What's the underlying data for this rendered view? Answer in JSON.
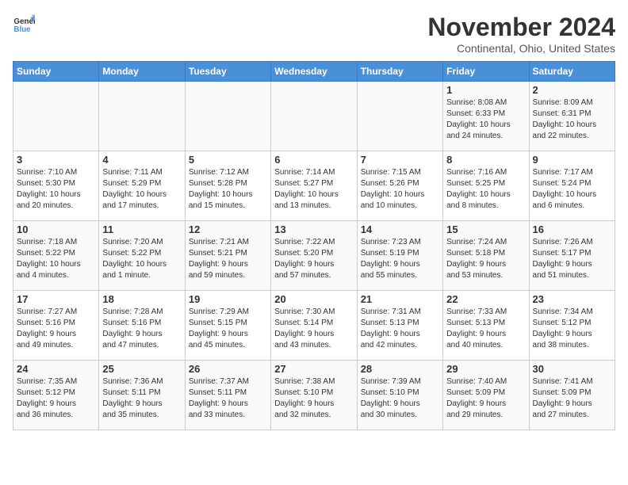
{
  "logo": {
    "line1": "General",
    "line2": "Blue"
  },
  "title": "November 2024",
  "subtitle": "Continental, Ohio, United States",
  "header": {
    "accent_color": "#4a90d9"
  },
  "weekdays": [
    "Sunday",
    "Monday",
    "Tuesday",
    "Wednesday",
    "Thursday",
    "Friday",
    "Saturday"
  ],
  "weeks": [
    [
      {
        "day": "",
        "info": ""
      },
      {
        "day": "",
        "info": ""
      },
      {
        "day": "",
        "info": ""
      },
      {
        "day": "",
        "info": ""
      },
      {
        "day": "",
        "info": ""
      },
      {
        "day": "1",
        "info": "Sunrise: 8:08 AM\nSunset: 6:33 PM\nDaylight: 10 hours\nand 24 minutes."
      },
      {
        "day": "2",
        "info": "Sunrise: 8:09 AM\nSunset: 6:31 PM\nDaylight: 10 hours\nand 22 minutes."
      }
    ],
    [
      {
        "day": "3",
        "info": "Sunrise: 7:10 AM\nSunset: 5:30 PM\nDaylight: 10 hours\nand 20 minutes."
      },
      {
        "day": "4",
        "info": "Sunrise: 7:11 AM\nSunset: 5:29 PM\nDaylight: 10 hours\nand 17 minutes."
      },
      {
        "day": "5",
        "info": "Sunrise: 7:12 AM\nSunset: 5:28 PM\nDaylight: 10 hours\nand 15 minutes."
      },
      {
        "day": "6",
        "info": "Sunrise: 7:14 AM\nSunset: 5:27 PM\nDaylight: 10 hours\nand 13 minutes."
      },
      {
        "day": "7",
        "info": "Sunrise: 7:15 AM\nSunset: 5:26 PM\nDaylight: 10 hours\nand 10 minutes."
      },
      {
        "day": "8",
        "info": "Sunrise: 7:16 AM\nSunset: 5:25 PM\nDaylight: 10 hours\nand 8 minutes."
      },
      {
        "day": "9",
        "info": "Sunrise: 7:17 AM\nSunset: 5:24 PM\nDaylight: 10 hours\nand 6 minutes."
      }
    ],
    [
      {
        "day": "10",
        "info": "Sunrise: 7:18 AM\nSunset: 5:22 PM\nDaylight: 10 hours\nand 4 minutes."
      },
      {
        "day": "11",
        "info": "Sunrise: 7:20 AM\nSunset: 5:22 PM\nDaylight: 10 hours\nand 1 minute."
      },
      {
        "day": "12",
        "info": "Sunrise: 7:21 AM\nSunset: 5:21 PM\nDaylight: 9 hours\nand 59 minutes."
      },
      {
        "day": "13",
        "info": "Sunrise: 7:22 AM\nSunset: 5:20 PM\nDaylight: 9 hours\nand 57 minutes."
      },
      {
        "day": "14",
        "info": "Sunrise: 7:23 AM\nSunset: 5:19 PM\nDaylight: 9 hours\nand 55 minutes."
      },
      {
        "day": "15",
        "info": "Sunrise: 7:24 AM\nSunset: 5:18 PM\nDaylight: 9 hours\nand 53 minutes."
      },
      {
        "day": "16",
        "info": "Sunrise: 7:26 AM\nSunset: 5:17 PM\nDaylight: 9 hours\nand 51 minutes."
      }
    ],
    [
      {
        "day": "17",
        "info": "Sunrise: 7:27 AM\nSunset: 5:16 PM\nDaylight: 9 hours\nand 49 minutes."
      },
      {
        "day": "18",
        "info": "Sunrise: 7:28 AM\nSunset: 5:16 PM\nDaylight: 9 hours\nand 47 minutes."
      },
      {
        "day": "19",
        "info": "Sunrise: 7:29 AM\nSunset: 5:15 PM\nDaylight: 9 hours\nand 45 minutes."
      },
      {
        "day": "20",
        "info": "Sunrise: 7:30 AM\nSunset: 5:14 PM\nDaylight: 9 hours\nand 43 minutes."
      },
      {
        "day": "21",
        "info": "Sunrise: 7:31 AM\nSunset: 5:13 PM\nDaylight: 9 hours\nand 42 minutes."
      },
      {
        "day": "22",
        "info": "Sunrise: 7:33 AM\nSunset: 5:13 PM\nDaylight: 9 hours\nand 40 minutes."
      },
      {
        "day": "23",
        "info": "Sunrise: 7:34 AM\nSunset: 5:12 PM\nDaylight: 9 hours\nand 38 minutes."
      }
    ],
    [
      {
        "day": "24",
        "info": "Sunrise: 7:35 AM\nSunset: 5:12 PM\nDaylight: 9 hours\nand 36 minutes."
      },
      {
        "day": "25",
        "info": "Sunrise: 7:36 AM\nSunset: 5:11 PM\nDaylight: 9 hours\nand 35 minutes."
      },
      {
        "day": "26",
        "info": "Sunrise: 7:37 AM\nSunset: 5:11 PM\nDaylight: 9 hours\nand 33 minutes."
      },
      {
        "day": "27",
        "info": "Sunrise: 7:38 AM\nSunset: 5:10 PM\nDaylight: 9 hours\nand 32 minutes."
      },
      {
        "day": "28",
        "info": "Sunrise: 7:39 AM\nSunset: 5:10 PM\nDaylight: 9 hours\nand 30 minutes."
      },
      {
        "day": "29",
        "info": "Sunrise: 7:40 AM\nSunset: 5:09 PM\nDaylight: 9 hours\nand 29 minutes."
      },
      {
        "day": "30",
        "info": "Sunrise: 7:41 AM\nSunset: 5:09 PM\nDaylight: 9 hours\nand 27 minutes."
      }
    ]
  ]
}
